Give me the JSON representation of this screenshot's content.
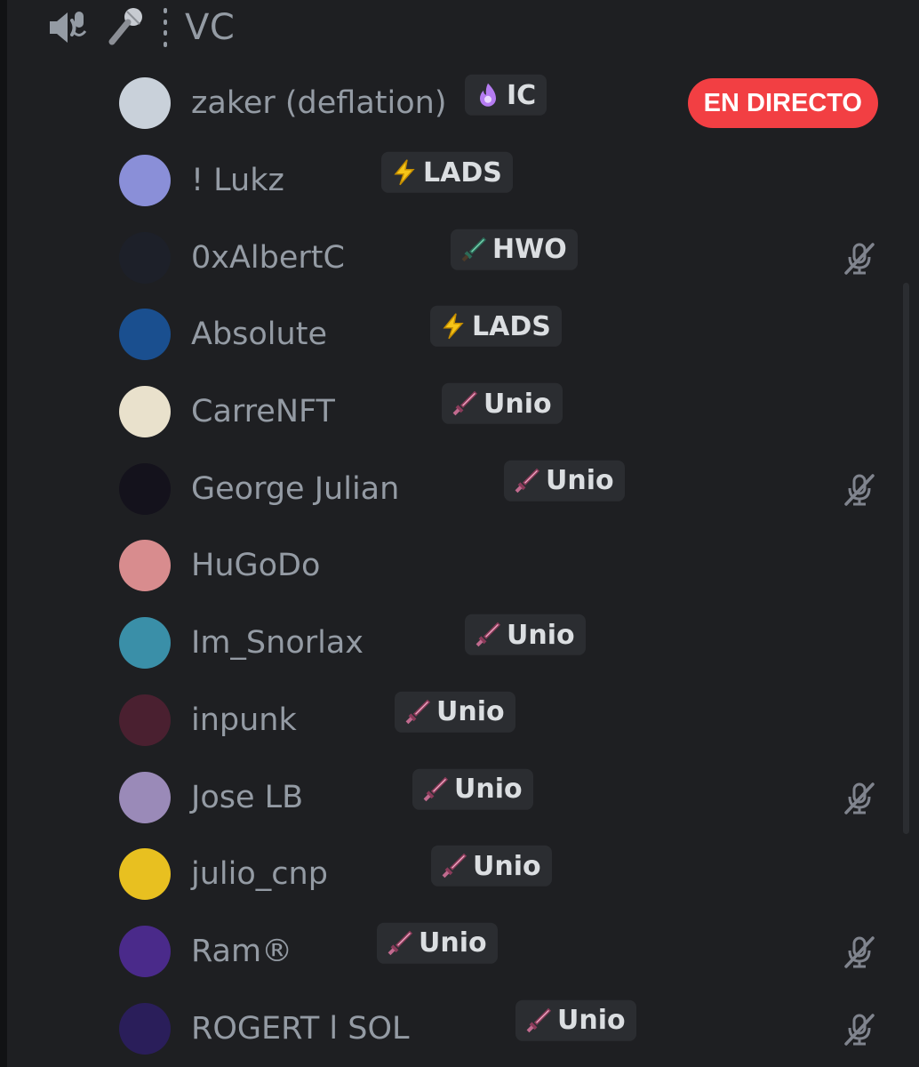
{
  "channel": {
    "name": "VC",
    "icons": [
      "speaker-icon",
      "microphone-icon"
    ]
  },
  "users": [
    {
      "name": "zaker (deflation)",
      "tag": "IC",
      "tag_icon": "purple-flame-icon",
      "avatar_color": "#c9d1da",
      "live": true,
      "muted": false
    },
    {
      "name": "! Lukz",
      "tag": "LADS",
      "tag_icon": "lightning-icon",
      "avatar_color": "#8a8fd8",
      "live": false,
      "muted": false
    },
    {
      "name": "0xAlbertC",
      "tag": "HWO",
      "tag_icon": "green-sword-icon",
      "avatar_color": "#1d2029",
      "live": false,
      "muted": true
    },
    {
      "name": "Absolute",
      "tag": "LADS",
      "tag_icon": "lightning-icon",
      "avatar_color": "#1a4f8f",
      "live": false,
      "muted": false
    },
    {
      "name": "CarreNFT",
      "tag": "Unio",
      "tag_icon": "pink-sword-icon",
      "avatar_color": "#e9e1cc",
      "live": false,
      "muted": false
    },
    {
      "name": "George Julian",
      "tag": "Unio",
      "tag_icon": "pink-sword-icon",
      "avatar_color": "#14121c",
      "live": false,
      "muted": true
    },
    {
      "name": "HuGoDo",
      "tag": "",
      "tag_icon": "",
      "avatar_color": "#d88c8e",
      "live": false,
      "muted": false
    },
    {
      "name": "Im_Snorlax",
      "tag": "Unio",
      "tag_icon": "pink-sword-icon",
      "avatar_color": "#3a8fa8",
      "live": false,
      "muted": false
    },
    {
      "name": "inpunk",
      "tag": "Unio",
      "tag_icon": "pink-sword-icon",
      "avatar_color": "#4a2030",
      "live": false,
      "muted": false
    },
    {
      "name": "Jose LB",
      "tag": "Unio",
      "tag_icon": "pink-sword-icon",
      "avatar_color": "#9a8ab8",
      "live": false,
      "muted": true
    },
    {
      "name": "julio_cnp",
      "tag": "Unio",
      "tag_icon": "pink-sword-icon",
      "avatar_color": "#e8c020",
      "live": false,
      "muted": false
    },
    {
      "name": "Ram®",
      "tag": "Unio",
      "tag_icon": "pink-sword-icon",
      "avatar_color": "#4a2a8a",
      "live": false,
      "muted": true
    },
    {
      "name": "ROGERT l SOL",
      "tag": "Unio",
      "tag_icon": "pink-sword-icon",
      "avatar_color": "#2a1e5a",
      "live": false,
      "muted": true
    }
  ],
  "live_label": "EN DIRECTO",
  "colors": {
    "background": "#1e1f22",
    "text_muted": "#949ba4",
    "tag_bg": "#2b2d31",
    "live_red": "#f23f43"
  }
}
